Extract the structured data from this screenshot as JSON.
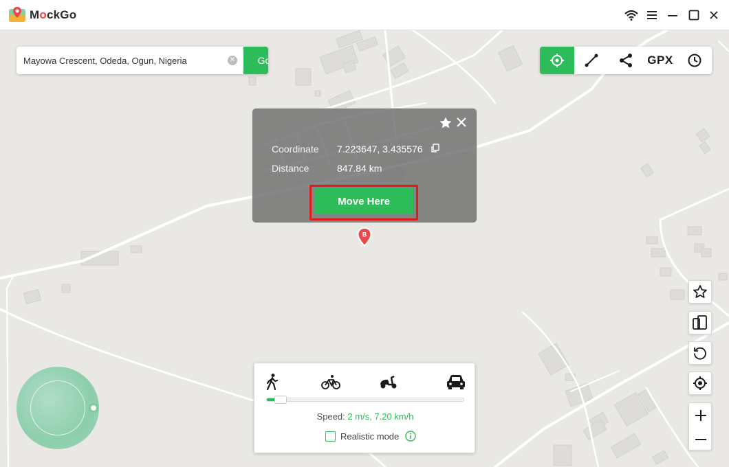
{
  "app": {
    "name_prefix": "M",
    "name_accent": "o",
    "name_suffix": "ckGo"
  },
  "search": {
    "value": "Mayowa Crescent, Odeda, Ogun, Nigeria",
    "go_label": "Go"
  },
  "toolbar": {
    "gpx_label": "GPX"
  },
  "popup": {
    "coordinate_label": "Coordinate",
    "coordinate_value": "7.223647, 3.435576",
    "distance_label": "Distance",
    "distance_value": "847.84 km",
    "move_button": "Move Here"
  },
  "pin": {
    "label": "B"
  },
  "speed_panel": {
    "speed_label": "Speed:",
    "speed_value": "2 m/s, 7.20 km/h",
    "realistic_label": "Realistic mode",
    "slider_level": 0.07
  },
  "colors": {
    "accent": "#2ebc5a",
    "highlight": "#e01b1b",
    "pin": "#e8494b"
  }
}
